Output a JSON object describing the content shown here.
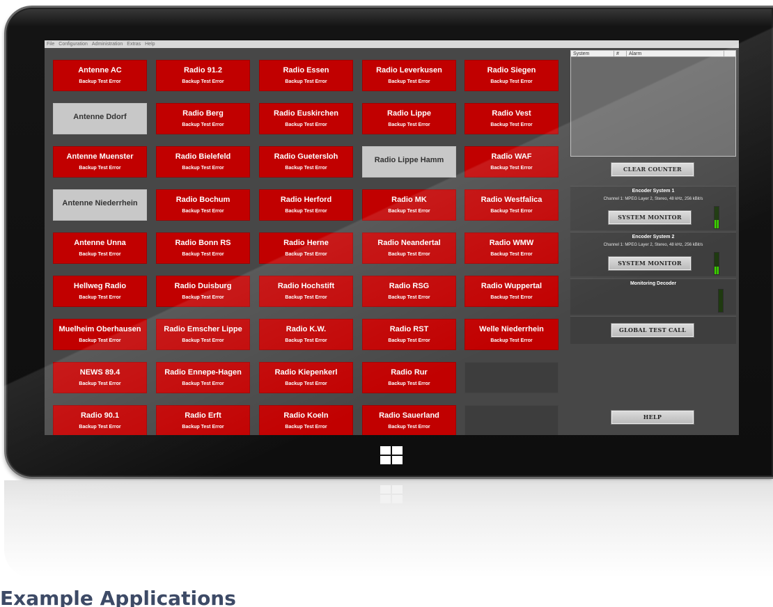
{
  "menu": [
    "File",
    "Configuration",
    "Administration",
    "Extras",
    "Help"
  ],
  "status_text": "Backup Test Error",
  "stations": [
    [
      "Antenne AC",
      "Radio 91.2",
      "Radio Essen",
      "Radio Leverkusen",
      "Radio Siegen"
    ],
    [
      "Antenne Ddorf",
      "Radio Berg",
      "Radio Euskirchen",
      "Radio Lippe",
      "Radio Vest"
    ],
    [
      "Antenne Muenster",
      "Radio Bielefeld",
      "Radio Guetersloh",
      "Radio Lippe Hamm",
      "Radio WAF"
    ],
    [
      "Antenne Niederrhein",
      "Radio Bochum",
      "Radio Herford",
      "Radio MK",
      "Radio Westfalica"
    ],
    [
      "Antenne Unna",
      "Radio Bonn RS",
      "Radio Herne",
      "Radio Neandertal",
      "Radio WMW"
    ],
    [
      "Hellweg Radio",
      "Radio Duisburg",
      "Radio Hochstift",
      "Radio RSG",
      "Radio Wuppertal"
    ],
    [
      "Muelheim Oberhausen",
      "Radio Emscher Lippe",
      "Radio K.W.",
      "Radio RST",
      "Welle Niederrhein"
    ],
    [
      "NEWS 89.4",
      "Radio Ennepe-Hagen",
      "Radio Kiepenkerl",
      "Radio Rur",
      ""
    ],
    [
      "Radio 90.1",
      "Radio Erft",
      "Radio Koeln",
      "Radio Sauerland",
      ""
    ]
  ],
  "alarm_table": {
    "col_system": "System",
    "col_num": "#",
    "col_alarm": "Alarm"
  },
  "buttons": {
    "clear_counter": "CLEAR COUNTER",
    "system_monitor": "SYSTEM MONITOR",
    "global_test_call": "GLOBAL TEST CALL",
    "help": "HELP"
  },
  "encoder1": {
    "title": "Encoder System 1",
    "info": "Channel 1: MPEG Layer 2, Stereo, 48 kHz, 256 kBit/s"
  },
  "encoder2": {
    "title": "Encoder System 2",
    "info": "Channel 1: MPEG Layer 2, Stereo, 48 kHz, 256 kBit/s"
  },
  "decoder": {
    "title": "Monitoring Decoder"
  },
  "caption": "Example Applications",
  "colors": {
    "error_red": "#c10000",
    "ok_grey": "#c8c8c8",
    "panel": "#474747",
    "meter_green": "#39d000"
  }
}
